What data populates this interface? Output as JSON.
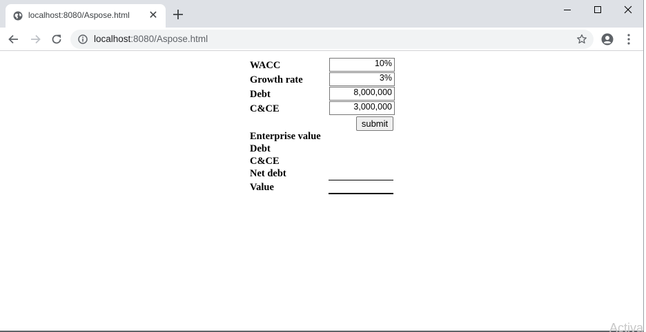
{
  "browser": {
    "tab_title": "localhost:8080/Aspose.html",
    "url_host": "localhost",
    "url_rest": ":8080/Aspose.html"
  },
  "form": {
    "fields": [
      {
        "label": "WACC",
        "value": "10%"
      },
      {
        "label": "Growth rate",
        "value": "3%"
      },
      {
        "label": "Debt",
        "value": "8,000,000"
      },
      {
        "label": "C&CE",
        "value": "3,000,000"
      }
    ],
    "submit_label": "submit"
  },
  "results": {
    "labels": [
      "Enterprise value",
      "Debt",
      "C&CE",
      "Net debt",
      "Value"
    ]
  },
  "watermark": "Activa",
  "icons": {
    "favicon": "globe-icon",
    "tab_close": "close-icon",
    "new_tab": "plus-icon",
    "back": "arrow-left-icon",
    "forward": "arrow-right-icon",
    "reload": "reload-icon",
    "site_info": "info-icon",
    "bookmark": "star-icon",
    "profile": "account-icon",
    "menu": "kebab-menu-icon"
  }
}
